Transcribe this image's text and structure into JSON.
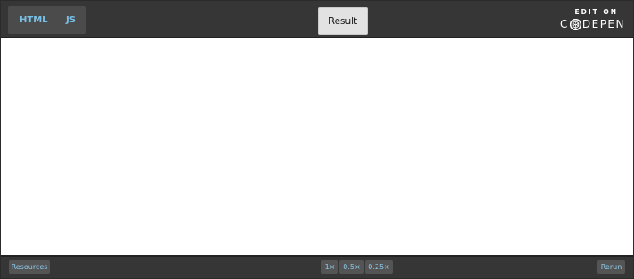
{
  "header": {
    "tabs": [
      {
        "label": "HTML"
      },
      {
        "label": "JS"
      }
    ],
    "result_label": "Result",
    "codepen": {
      "edit_label": "EDIT ON",
      "brand_before": "C",
      "brand_after": "DEPEN"
    }
  },
  "footer": {
    "resources_label": "Resources",
    "zoom_options": [
      "1×",
      "0.5×",
      "0.25×"
    ],
    "rerun_label": "Rerun"
  },
  "colors": {
    "bar": "#363636",
    "accent_text": "#79c0e6",
    "button_bg": "#545454",
    "result_bg": "#e2e2e2"
  },
  "icons": {
    "codepen_logo": "codepen-cube-icon"
  }
}
